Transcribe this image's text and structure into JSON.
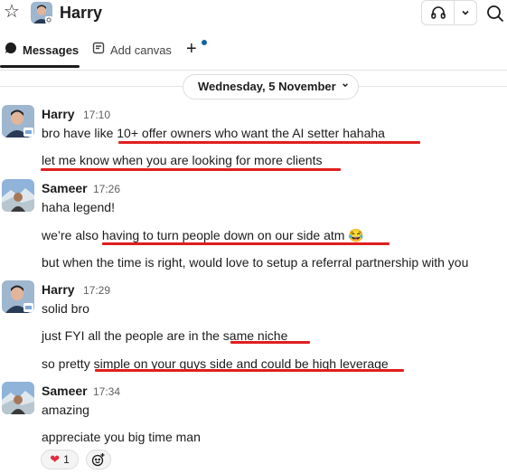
{
  "header": {
    "channel_name": "Harry"
  },
  "tabs": {
    "messages": "Messages",
    "canvas": "Add canvas"
  },
  "date_divider": "Wednesday, 5 November",
  "messages": [
    {
      "sender": "Harry",
      "time": "17:10",
      "lines": [
        "bro have like 10+ offer owners who want the AI setter hahaha",
        "let me know when you are looking for more clients"
      ]
    },
    {
      "sender": "Sameer",
      "time": "17:26",
      "lines": [
        "haha legend!",
        "we’re also having to turn people down on our side atm 😂",
        "but when the time is right, would love to setup a referral partnership with you"
      ]
    },
    {
      "sender": "Harry",
      "time": "17:29",
      "lines": [
        "solid bro",
        "just FYI all the people are in the same niche",
        "so pretty simple on your guys side and could be high leverage"
      ]
    },
    {
      "sender": "Sameer",
      "time": "17:34",
      "lines": [
        "amazing",
        "appreciate you big time man"
      ]
    }
  ],
  "reactions": [
    {
      "emoji": "heart",
      "count": "1"
    }
  ],
  "colors": {
    "underline": "#e01e1e",
    "accent_dot": "#1264a3"
  }
}
